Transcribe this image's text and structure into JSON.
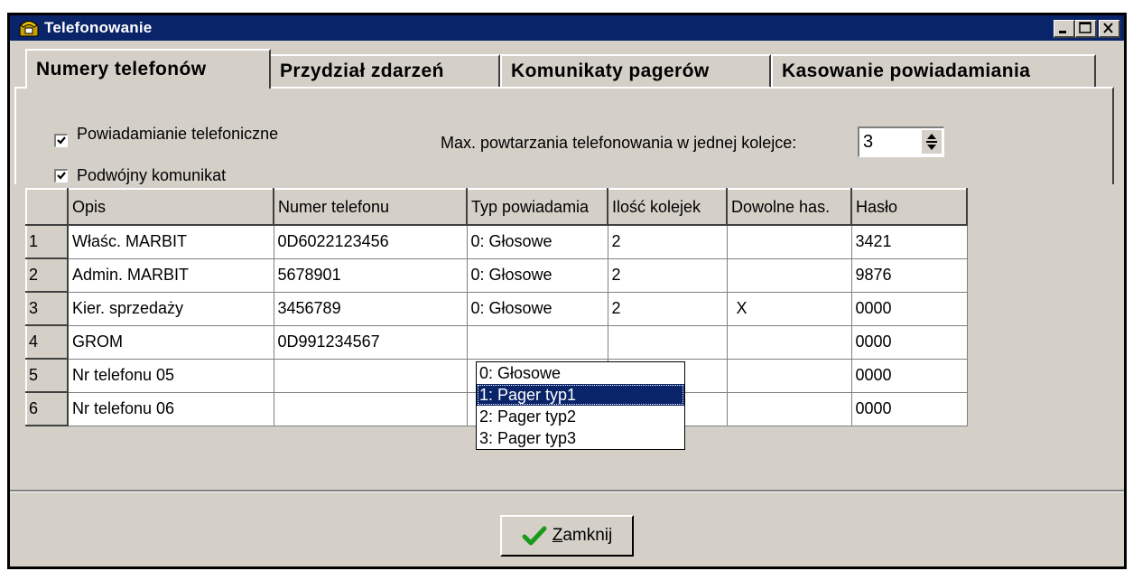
{
  "window": {
    "title": "Telefonowanie",
    "title_icon": "phone-icon",
    "controls": [
      "minimize-icon",
      "maximize-icon",
      "close-icon"
    ]
  },
  "tabs": [
    {
      "label": "Numery telefonów",
      "active": true
    },
    {
      "label": "Przydział zdarzeń",
      "active": false
    },
    {
      "label": "Komunikaty pagerów",
      "active": false
    },
    {
      "label": "Kasowanie powiadamiania",
      "active": false
    }
  ],
  "options": {
    "phone_notify_label": "Powiadamianie telefoniczne",
    "phone_notify_checked": true,
    "double_msg_label": "Podwójny komunikat",
    "double_msg_checked": true,
    "max_repeat_label": "Max. powtarzania telefonowania w jednej kolejce:",
    "max_repeat_value": "3"
  },
  "table": {
    "columns": [
      "Opis",
      "Numer telefonu",
      "Typ powiadamia",
      "Ilość kolejek",
      "Dowolne has.",
      "Hasło"
    ],
    "rows": [
      {
        "n": "1",
        "opis": "Właśc. MARBIT",
        "numer": "0D6022123456",
        "typ": "0: Głosowe",
        "ilosc": "2",
        "dowolne": "",
        "haslo": "3421"
      },
      {
        "n": "2",
        "opis": "Admin. MARBIT",
        "numer": "5678901",
        "typ": "0: Głosowe",
        "ilosc": "2",
        "dowolne": "",
        "haslo": "9876"
      },
      {
        "n": "3",
        "opis": "Kier. sprzedaży",
        "numer": "3456789",
        "typ": "0: Głosowe",
        "ilosc": "2",
        "dowolne": "X",
        "haslo": "0000"
      },
      {
        "n": "4",
        "opis": "GROM",
        "numer": "0D991234567",
        "typ": "",
        "ilosc": "",
        "dowolne": "",
        "haslo": "0000"
      },
      {
        "n": "5",
        "opis": "Nr telefonu  05",
        "numer": "",
        "typ": "",
        "ilosc": "",
        "dowolne": "",
        "haslo": "0000"
      },
      {
        "n": "6",
        "opis": "Nr telefonu  06",
        "numer": "",
        "typ": "",
        "ilosc": "",
        "dowolne": "",
        "haslo": "0000"
      }
    ]
  },
  "dropdown": {
    "options": [
      "0: Głosowe",
      "1: Pager typ1",
      "2: Pager typ2",
      "3: Pager typ3"
    ],
    "selected": "1: Pager typ1"
  },
  "footer": {
    "close_label_first": "Z",
    "close_label_rest": "amknij",
    "close_icon": "checkmark-icon"
  }
}
